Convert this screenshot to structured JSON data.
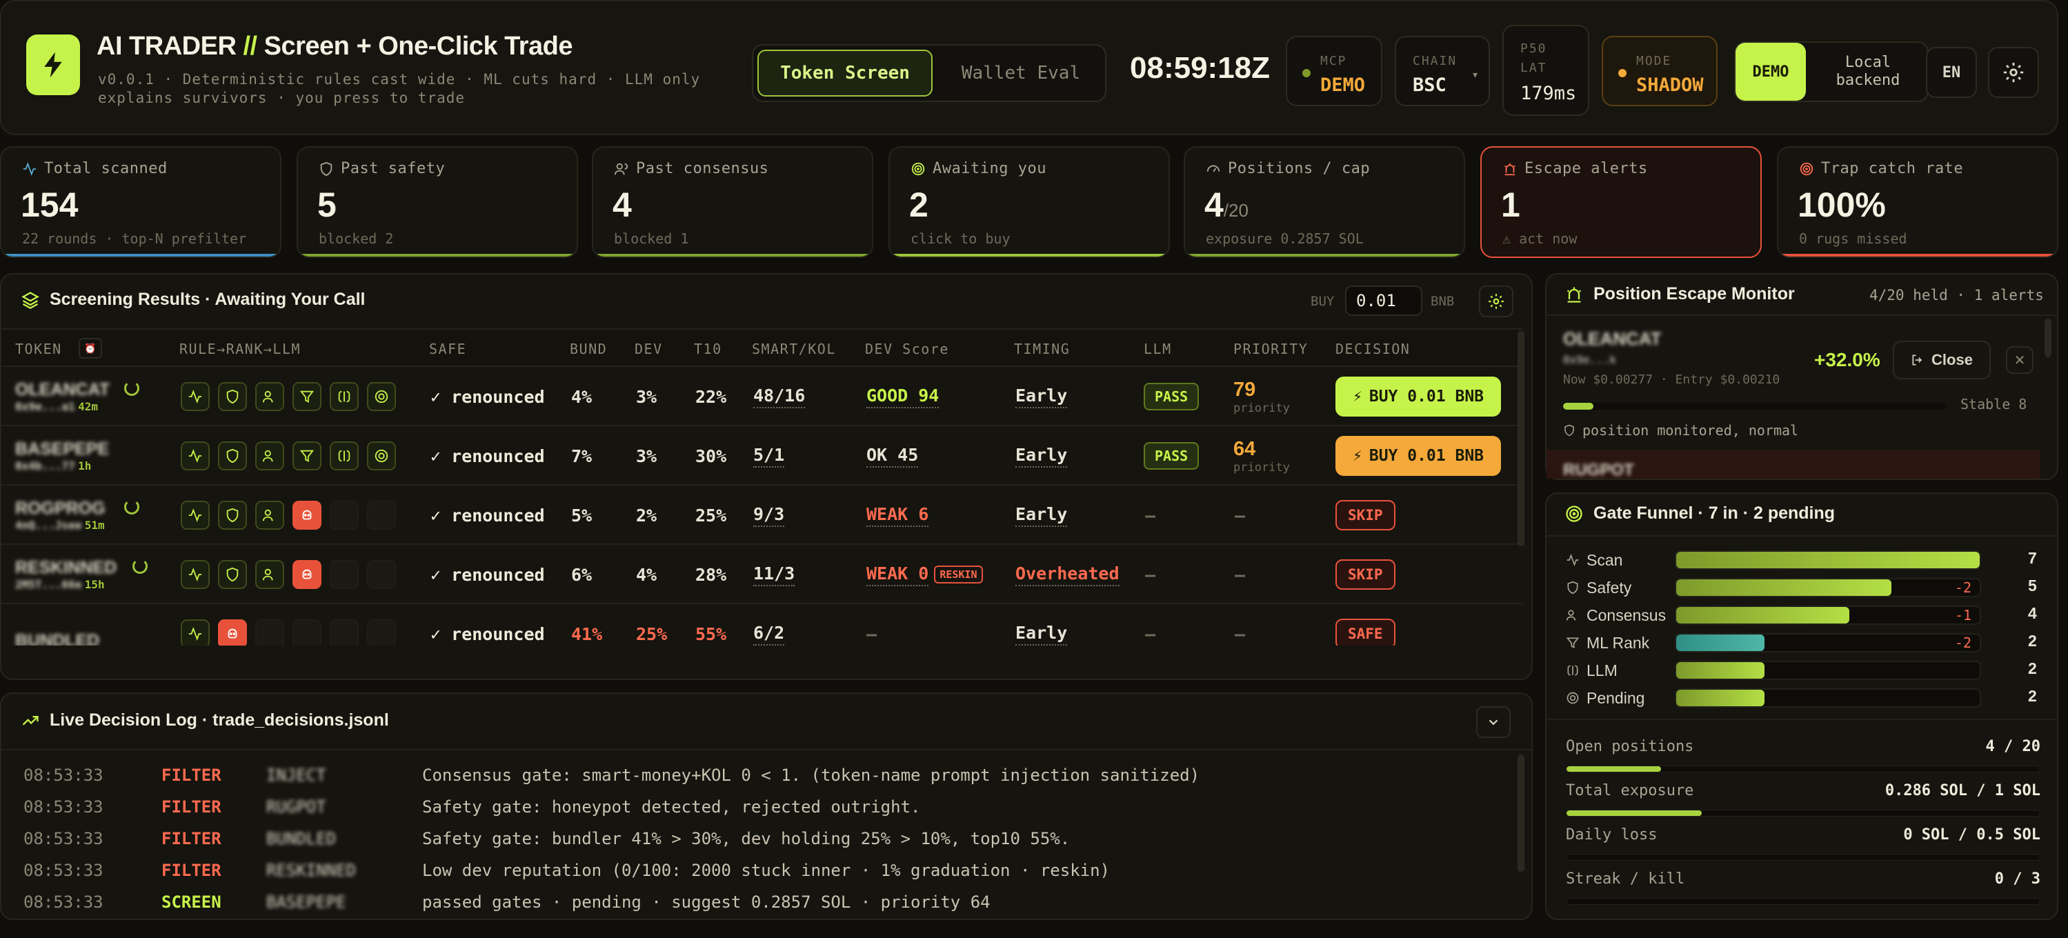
{
  "header": {
    "title_a": "AI TRADER",
    "title_slash": "//",
    "title_b": "Screen + One-Click Trade",
    "subtitle": "v0.0.1 · Deterministic rules cast wide · ML cuts hard · LLM only explains survivors · you press to trade",
    "tabs": [
      "Token Screen",
      "Wallet Eval"
    ],
    "clock": "08:59:18Z",
    "mcp": {
      "k": "MCP",
      "v": "DEMO"
    },
    "chain": {
      "k": "CHAIN",
      "v": "BSC"
    },
    "lat": {
      "k1": "P50",
      "k2": "LAT",
      "v": "179ms"
    },
    "mode": {
      "k": "MODE",
      "v": "SHADOW"
    },
    "demo_label": "DEMO",
    "backend_label": "Local backend",
    "lang": "EN",
    "colors": {
      "accent": "#c6f34a",
      "warn": "#f4a93a",
      "danger": "#e8523b"
    }
  },
  "stats": [
    {
      "label": "Total scanned",
      "value": "154",
      "sub": "22 rounds · top-N prefilter"
    },
    {
      "label": "Past safety",
      "value": "5",
      "sub": "blocked 2"
    },
    {
      "label": "Past consensus",
      "value": "4",
      "sub": "blocked 1"
    },
    {
      "label": "Awaiting you",
      "value": "2",
      "sub": "click to buy"
    },
    {
      "label": "Positions / cap",
      "value": "4",
      "value_small": "/20",
      "sub": "exposure 0.2857 SOL"
    },
    {
      "label": "Escape alerts",
      "value": "1",
      "sub": "⚠ act now"
    },
    {
      "label": "Trap catch rate",
      "value": "100%",
      "sub": "0 rugs missed"
    }
  ],
  "results": {
    "title": "Screening Results · Awaiting Your Call",
    "buy_label": "BUY",
    "buy_amount": "0.01",
    "buy_unit": "BNB",
    "columns": [
      "TOKEN",
      "RULE→RANK→LLM",
      "SAFE",
      "BUND",
      "DEV",
      "T10",
      "SMART/KOL",
      "DEV Score",
      "TIMING",
      "LLM",
      "PRIORITY",
      "DECISION"
    ],
    "rows": [
      {
        "token": "OLEANCAT",
        "sub": "0x9e...a1",
        "age": "42m",
        "safe": "✓ renounced",
        "bund": "4%",
        "dev": "3%",
        "t10": "22%",
        "smart": "48/16",
        "devscore": "GOOD 94",
        "timing": "Early",
        "llm": "PASS",
        "priority": "79",
        "priority_label": "priority",
        "decision": "BUY 0.01 BNB"
      },
      {
        "token": "BASEPEPE",
        "sub": "0x4b...77",
        "age": "1h",
        "safe": "✓ renounced",
        "bund": "7%",
        "dev": "3%",
        "t10": "30%",
        "smart": "5/1",
        "devscore": "OK 45",
        "timing": "Early",
        "llm": "PASS",
        "priority": "64",
        "priority_label": "priority",
        "decision": "BUY 0.01 BNB"
      },
      {
        "token": "ROGPROG",
        "sub": "4nQ...Jsee",
        "age": "51m",
        "safe": "✓ renounced",
        "bund": "5%",
        "dev": "2%",
        "t10": "25%",
        "smart": "9/3",
        "devscore": "WEAK 6",
        "timing": "Early",
        "llm": "—",
        "priority": "—",
        "decision": "SKIP"
      },
      {
        "token": "RESKINNED",
        "sub": "2M5T...66e",
        "age": "15h",
        "safe": "✓ renounced",
        "bund": "6%",
        "dev": "4%",
        "t10": "28%",
        "smart": "11/3",
        "devscore": "WEAK 0",
        "devscore_tag": "RESKIN",
        "timing": "Overheated",
        "llm": "—",
        "priority": "—",
        "decision": "SKIP"
      },
      {
        "token": "BUNDLED",
        "safe": "✓ renounced",
        "bund": "41%",
        "dev": "25%",
        "t10": "55%",
        "smart": "6/2",
        "devscore": "—",
        "timing": "Early",
        "llm": "—",
        "priority": "—",
        "decision": "SAFE"
      }
    ]
  },
  "log": {
    "title": "Live Decision Log · trade_decisions.jsonl",
    "entries": [
      {
        "time": "08:53:33",
        "kind": "FILTER",
        "token": "INJECT",
        "msg": "Consensus gate: smart-money+KOL 0 < 1. (token-name prompt injection sanitized)"
      },
      {
        "time": "08:53:33",
        "kind": "FILTER",
        "token": "RUGPOT",
        "msg": "Safety gate: honeypot detected, rejected outright."
      },
      {
        "time": "08:53:33",
        "kind": "FILTER",
        "token": "BUNDLED",
        "msg": "Safety gate: bundler 41% > 30%, dev holding 25% > 10%, top10 55%."
      },
      {
        "time": "08:53:33",
        "kind": "FILTER",
        "token": "RESKINNED",
        "msg": "Low dev reputation (0/100: 2000 stuck inner · 1% graduation · reskin)"
      },
      {
        "time": "08:53:33",
        "kind": "SCREEN",
        "token": "BASEPEPE",
        "msg": "passed gates · pending · suggest 0.2857 SOL · priority 64"
      }
    ]
  },
  "escape": {
    "title": "Position Escape Monitor",
    "meta": "4/20 held · 1 alerts",
    "pos": {
      "token": "OLEANCAT",
      "sub": "0x9e...k",
      "pnl": "+32.0%",
      "prices": "Now $0.00277 · Entry $0.00210",
      "close": "Close",
      "stable": "Stable 8",
      "status": "position monitored, normal",
      "progress": 0.08
    },
    "next_token": "RUGPOT"
  },
  "funnel": {
    "title": "Gate Funnel · ",
    "title_b": "7 in · 2 pending",
    "rows": [
      {
        "label": "Scan",
        "value": "7",
        "delta": "",
        "frac": 1.0
      },
      {
        "label": "Safety",
        "value": "5",
        "delta": "-2",
        "frac": 0.71
      },
      {
        "label": "Consensus",
        "value": "4",
        "delta": "-1",
        "frac": 0.57
      },
      {
        "label": "ML Rank",
        "value": "2",
        "delta": "-2",
        "frac": 0.29
      },
      {
        "label": "LLM",
        "value": "2",
        "delta": "",
        "frac": 0.29
      },
      {
        "label": "Pending",
        "value": "2",
        "delta": "",
        "frac": 0.29
      }
    ],
    "limits": [
      {
        "label": "Open positions",
        "value": "4 / 20",
        "frac": 0.2
      },
      {
        "label": "Total exposure",
        "value": "0.286 SOL / 1 SOL",
        "frac": 0.286
      },
      {
        "label": "Daily loss",
        "value": "0 SOL / 0.5 SOL",
        "frac": 0
      },
      {
        "label": "Streak / kill",
        "value": "0 / 3",
        "frac": 0
      }
    ]
  }
}
